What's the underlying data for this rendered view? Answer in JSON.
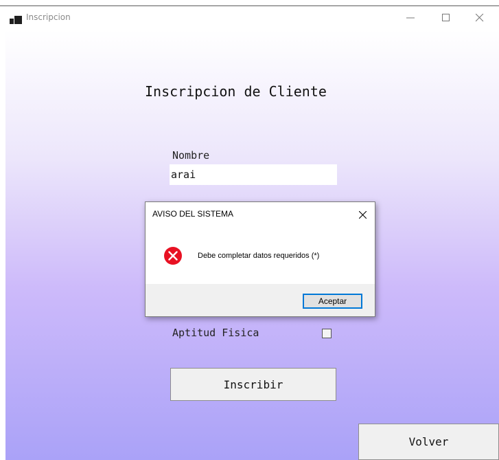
{
  "window": {
    "title": "Inscripcion",
    "controls": [
      "minimize",
      "maximize",
      "close"
    ]
  },
  "form": {
    "heading": "Inscripcion de Cliente",
    "nombre_label": "Nombre",
    "nombre_value": "arai",
    "aptitud_label": "Aptitud Fisica",
    "aptitud_checked": false,
    "inscribir_label": "Inscribir",
    "volver_label": "Volver"
  },
  "dialog": {
    "title": "AVISO DEL SISTEMA",
    "message": "Debe completar datos requeridos (*)",
    "icon": "error-icon",
    "ok_label": "Aceptar"
  },
  "colors": {
    "gradient_top": "#ffffff",
    "gradient_bottom": "#aaa2f8",
    "error_red": "#e81123",
    "focus_blue": "#0078d7"
  }
}
